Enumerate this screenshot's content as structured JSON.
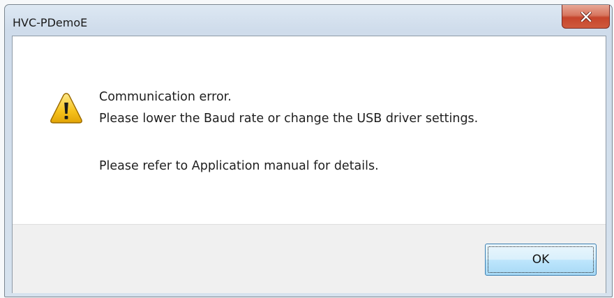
{
  "window": {
    "title": "HVC-PDemoE",
    "close_icon": "close-icon"
  },
  "message": {
    "icon": "warning-icon",
    "line1": "Communication error.",
    "line2": "Please lower the Baud rate or change the USB driver settings.",
    "line3": "Please refer to Application manual for details."
  },
  "buttons": {
    "ok_label": "OK"
  },
  "colors": {
    "close_button": "#c6452c",
    "ok_button_border": "#3c7fb1",
    "warning_fill": "#f6c21c"
  }
}
